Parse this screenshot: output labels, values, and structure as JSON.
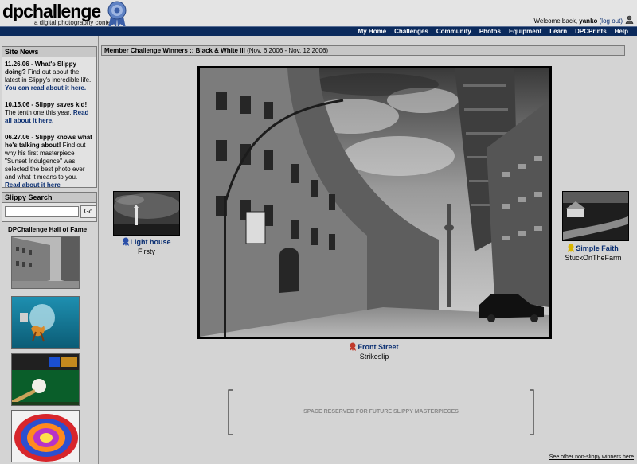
{
  "header": {
    "logo": "dpchallenge",
    "tagline": "a digital photography contest",
    "welcome_prefix": "Welcome back, ",
    "username": "yanko",
    "logout": "(log out)",
    "nav": [
      "My Home",
      "Challenges",
      "Community",
      "Photos",
      "Equipment",
      "Learn",
      "DPCPrints",
      "Help"
    ]
  },
  "sidebar": {
    "news_title": "Site News",
    "news": [
      {
        "head": "11.26.06 - What's Slippy doing?",
        "body": " Find out about the latest in Slippy's incredible life. ",
        "link": "You can read about it here."
      },
      {
        "head": "10.15.06 - Slippy saves kid!",
        "body": " The tenth one this year. ",
        "link": "Read all about it here."
      },
      {
        "head": "06.27.06 - Slippy knows what he's talking about!",
        "body": " Find out why his first masterpiece \"Sunset Indulgence\" was selected the best photo ever and what it means to you. ",
        "link": "Read about it here"
      }
    ],
    "search_title": "Slippy Search",
    "search_value": "",
    "search_button": "Go",
    "hof_title": "DPChallenge Hall of Fame"
  },
  "main": {
    "title_bold": "Member Challenge Winners :: Black & White III",
    "title_dates": " (Nov. 6 2006 - Nov. 12 2006)",
    "first": {
      "title": "Front Street",
      "author": "Strikeslip",
      "ribbon_color": "#c0392b"
    },
    "second": {
      "title": "Light house",
      "author": "Firsty",
      "ribbon_color": "#2a4fa8"
    },
    "third": {
      "title": "Simple Faith",
      "author": "StuckOnTheFarm",
      "ribbon_color": "#d8b400"
    },
    "reserved": "SPACE RESERVED FOR FUTURE SLIPPY MASTERPIECES",
    "other_link": "See other non-slippy winners here"
  }
}
